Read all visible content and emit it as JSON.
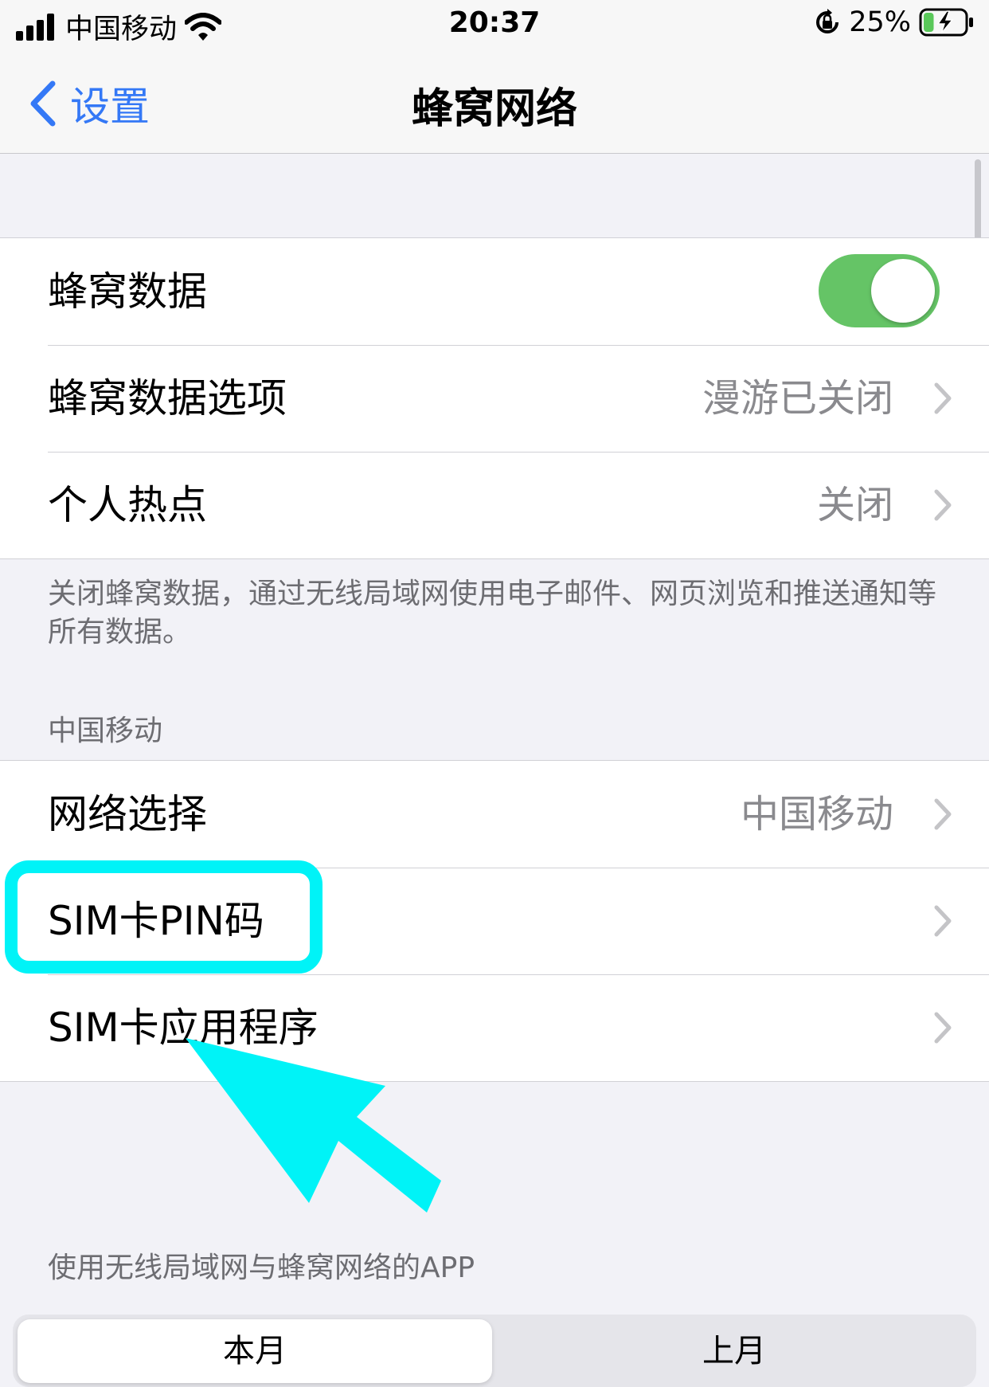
{
  "status_bar": {
    "carrier": "中国移动",
    "time": "20:37",
    "battery_percent": "25%",
    "battery_level": 0.25,
    "icons": [
      "signal-icon",
      "wifi-icon",
      "orientation-lock-icon",
      "battery-charging-icon"
    ]
  },
  "nav": {
    "back_label": "设置",
    "title": "蜂窝网络"
  },
  "group1": {
    "cellular_data_label": "蜂窝数据",
    "cellular_data_on": true,
    "cellular_options_label": "蜂窝数据选项",
    "cellular_options_value": "漫游已关闭",
    "hotspot_label": "个人热点",
    "hotspot_value": "关闭"
  },
  "footnote": "关闭蜂窝数据，通过无线局域网使用电子邮件、网页浏览和推送通知等所有数据。",
  "carrier_section": {
    "header": "中国移动",
    "network_select_label": "网络选择",
    "network_select_value": "中国移动",
    "sim_pin_label": "SIM卡PIN码",
    "sim_apps_label": "SIM卡应用程序"
  },
  "apps_section_header": "使用无线局域网与蜂窝网络的APP",
  "segmented": {
    "this_month": "本月",
    "last_month": "上月"
  },
  "colors": {
    "accent_blue": "#3478f6",
    "toggle_green": "#65c466",
    "highlight_cyan": "#00f3f7",
    "battery_green": "#5ac85a"
  }
}
